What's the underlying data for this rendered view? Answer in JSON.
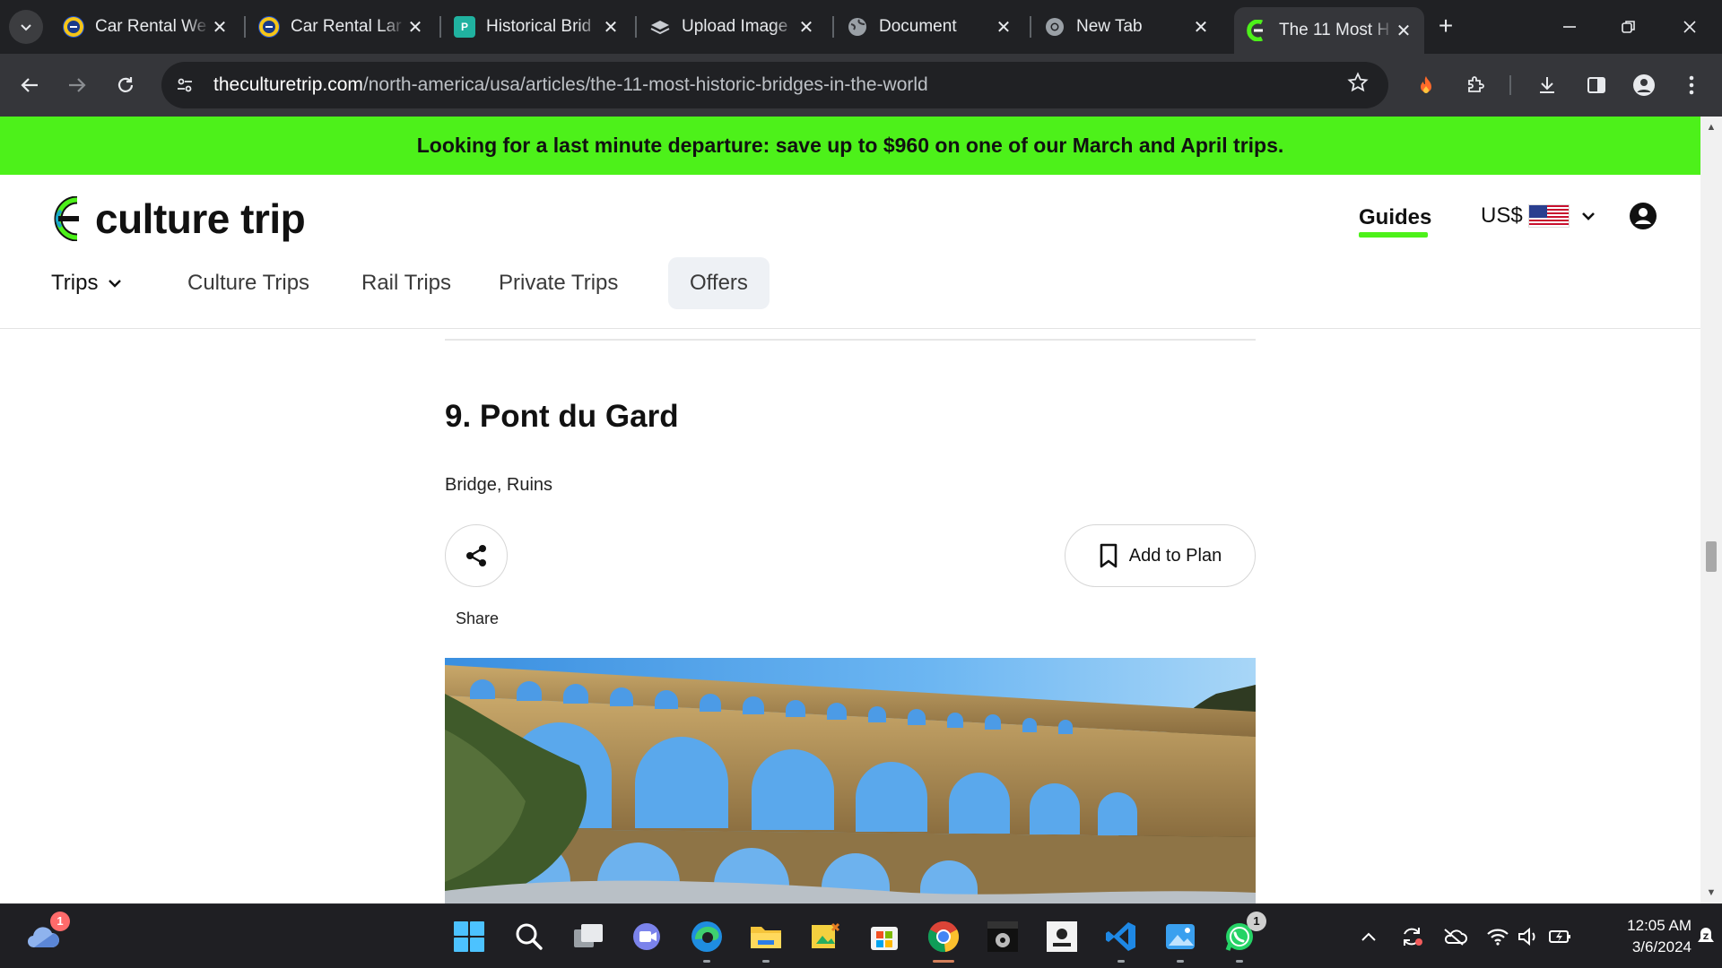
{
  "browser": {
    "tabs": [
      {
        "title": "Car Rental We",
        "icon": "shield-logo-icon",
        "active": false
      },
      {
        "title": "Car Rental Lar",
        "icon": "shield-logo-icon",
        "active": false
      },
      {
        "title": "Historical Brid",
        "icon": "doc-p-icon",
        "active": false
      },
      {
        "title": "Upload Image",
        "icon": "layers-icon",
        "active": false
      },
      {
        "title": "Document",
        "icon": "globe-icon",
        "active": false
      },
      {
        "title": "New Tab",
        "icon": "chrome-icon",
        "active": false
      },
      {
        "title": "The 11 Most H",
        "icon": "culture-trip-icon",
        "active": true
      }
    ],
    "url_host": "theculturetrip.com",
    "url_path": "/north-america/usa/articles/the-11-most-historic-bridges-in-the-world"
  },
  "promo": {
    "text": "Looking for a last minute departure: save up to $960 on one of our March and April trips.",
    "color": "#4df11a"
  },
  "header": {
    "logo_text": "culture trip",
    "guides_label": "Guides",
    "currency_label": "US$"
  },
  "nav": {
    "trips_label": "Trips",
    "culture_trips_label": "Culture Trips",
    "rail_trips_label": "Rail Trips",
    "private_trips_label": "Private Trips",
    "offers_label": "Offers"
  },
  "article": {
    "heading": "9. Pont du Gard",
    "tags": "Bridge, Ruins",
    "share_label": "Share",
    "add_to_plan_label": "Add to Plan"
  },
  "taskbar": {
    "weather_badge": "1",
    "whatsapp_badge": "1",
    "time": "12:05 AM",
    "date": "3/6/2024"
  }
}
